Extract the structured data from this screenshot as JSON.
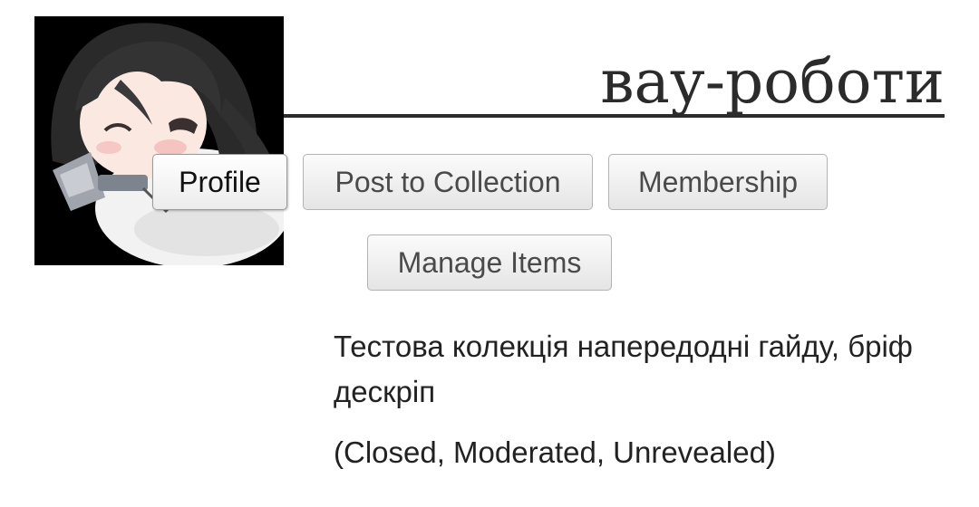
{
  "collection": {
    "title": "вау-роботи",
    "description": "Тестова колекція напередодні гайду, бріф дескріп",
    "status": "(Closed, Moderated, Unrevealed)"
  },
  "avatar": {
    "icon": "anime-character-avatar",
    "background_color": "#000000"
  },
  "nav": {
    "profile_label": "Profile",
    "post_label": "Post to Collection",
    "membership_label": "Membership",
    "manage_label": "Manage Items",
    "active": "profile"
  }
}
